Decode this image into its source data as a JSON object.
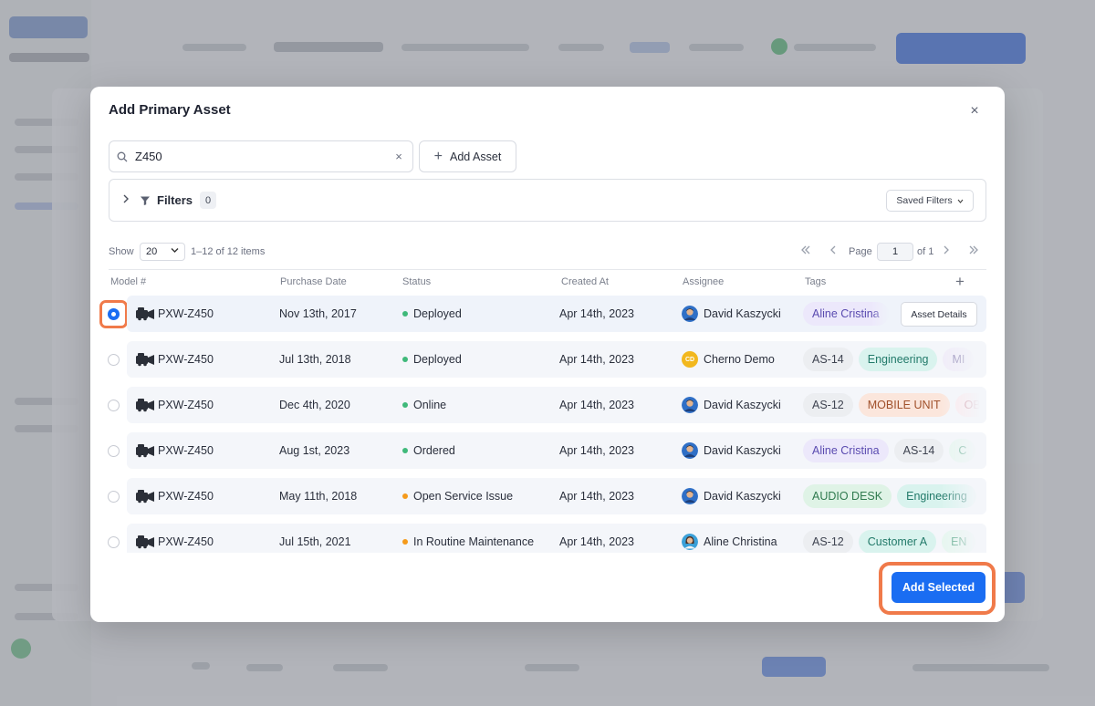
{
  "modal": {
    "title": "Add Primary Asset",
    "close_label": "×"
  },
  "search": {
    "value": "Z450",
    "clear_label": "×"
  },
  "toolbar": {
    "add_asset_label": "Add Asset"
  },
  "filters": {
    "label": "Filters",
    "count": "0",
    "saved_filters_label": "Saved Filters"
  },
  "pagination": {
    "show_label": "Show",
    "page_size": "20",
    "items_label": "1–12 of 12 items",
    "page_label": "Page",
    "current_page": "1",
    "of_label": "of 1"
  },
  "table": {
    "columns": [
      "Model #",
      "Purchase Date",
      "Status",
      "Created At",
      "Assignee",
      "Tags"
    ],
    "rows": [
      {
        "model": "PXW-Z450",
        "purchase_date": "Nov 13th, 2017",
        "status": "Deployed",
        "status_color": "#3fb97a",
        "created_at": "Apr 14th, 2023",
        "assignee": "David Kaszycki",
        "avatar": "photo-male",
        "tags": [
          {
            "label": "Aline Cristina",
            "bg": "#ece8fb",
            "fg": "#5a4bb0"
          }
        ],
        "selected": true,
        "action_label": "Asset Details"
      },
      {
        "model": "PXW-Z450",
        "purchase_date": "Jul 13th, 2018",
        "status": "Deployed",
        "status_color": "#3fb97a",
        "created_at": "Apr 14th, 2023",
        "assignee": "Cherno Demo",
        "avatar": "initials",
        "initials": "CD",
        "tags": [
          {
            "label": "AS-14",
            "bg": "#eceef1",
            "fg": "#3e4350"
          },
          {
            "label": "Engineering",
            "bg": "#d9f3ee",
            "fg": "#227a6a"
          },
          {
            "label": "MI",
            "bg": "#f0ecf8",
            "fg": "#8a7fb0"
          }
        ],
        "selected": false
      },
      {
        "model": "PXW-Z450",
        "purchase_date": "Dec 4th, 2020",
        "status": "Online",
        "status_color": "#3fb97a",
        "created_at": "Apr 14th, 2023",
        "assignee": "David Kaszycki",
        "avatar": "photo-male",
        "tags": [
          {
            "label": "AS-12",
            "bg": "#eceef1",
            "fg": "#3e4350"
          },
          {
            "label": "MOBILE UNIT",
            "bg": "#fbe6dc",
            "fg": "#a0502a"
          },
          {
            "label": "OB",
            "bg": "#fbe8ec",
            "fg": "#c07080"
          }
        ],
        "selected": false
      },
      {
        "model": "PXW-Z450",
        "purchase_date": "Aug 1st, 2023",
        "status": "Ordered",
        "status_color": "#3fb97a",
        "created_at": "Apr 14th, 2023",
        "assignee": "David Kaszycki",
        "avatar": "photo-male",
        "tags": [
          {
            "label": "Aline Cristina",
            "bg": "#ece8fb",
            "fg": "#5a4bb0"
          },
          {
            "label": "AS-14",
            "bg": "#eceef1",
            "fg": "#3e4350"
          },
          {
            "label": "C",
            "bg": "#e6f6ef",
            "fg": "#5aa888"
          }
        ],
        "selected": false
      },
      {
        "model": "PXW-Z450",
        "purchase_date": "May 11th, 2018",
        "status": "Open Service Issue",
        "status_color": "#f59a1b",
        "created_at": "Apr 14th, 2023",
        "assignee": "David Kaszycki",
        "avatar": "photo-male",
        "tags": [
          {
            "label": "AUDIO DESK",
            "bg": "#dff3e6",
            "fg": "#2f7a4e"
          },
          {
            "label": "Engineering",
            "bg": "#d9f3ee",
            "fg": "#227a6a"
          }
        ],
        "selected": false
      },
      {
        "model": "PXW-Z450",
        "purchase_date": "Jul 15th, 2021",
        "status": "In Routine Maintenance",
        "status_color": "#f59a1b",
        "created_at": "Apr 14th, 2023",
        "assignee": "Aline Christina",
        "avatar": "photo-female",
        "tags": [
          {
            "label": "AS-12",
            "bg": "#eceef1",
            "fg": "#3e4350"
          },
          {
            "label": "Customer A",
            "bg": "#d9f3ee",
            "fg": "#227a6a"
          },
          {
            "label": "EN",
            "bg": "#e6f6ef",
            "fg": "#5aa888"
          }
        ],
        "selected": false
      }
    ]
  },
  "footer": {
    "add_selected_label": "Add Selected"
  },
  "colors": {
    "accent": "#1a6df2",
    "highlight": "#f07a4a"
  }
}
